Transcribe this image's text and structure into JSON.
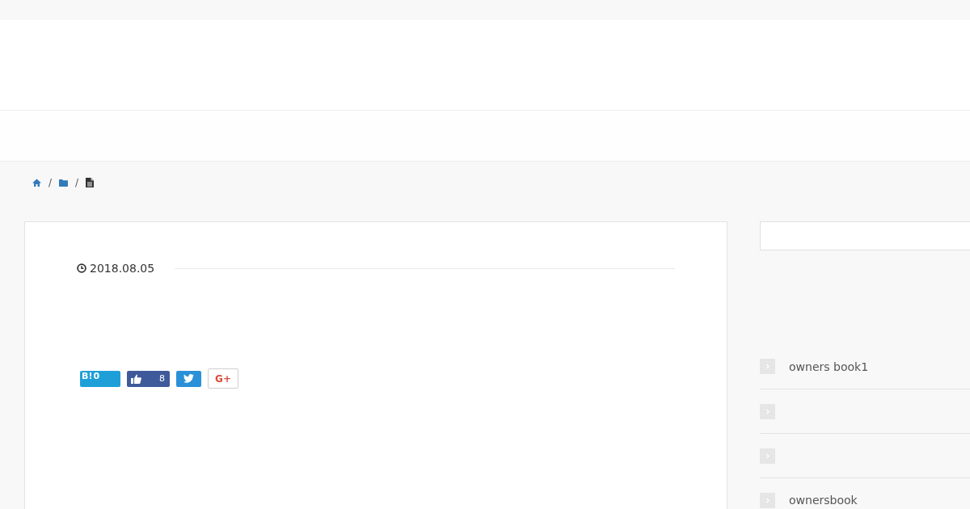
{
  "breadcrumb": [
    {
      "kind": "home"
    },
    {
      "kind": "separator",
      "text": "/"
    },
    {
      "kind": "folder"
    },
    {
      "kind": "separator",
      "text": "/"
    },
    {
      "kind": "page"
    }
  ],
  "post": {
    "date": "2018.08.05",
    "share_buttons": [
      {
        "kind": "bookmark",
        "label": "B!",
        "count": "0"
      },
      {
        "kind": "like",
        "count": "8"
      },
      {
        "kind": "tweet"
      },
      {
        "kind": "plus",
        "label": "G+"
      }
    ]
  },
  "sidebar": {
    "links": [
      {
        "kind": "text",
        "label": "owners book1"
      },
      {
        "kind": "blank"
      },
      {
        "kind": "blank"
      },
      {
        "kind": "text",
        "label": "ownersbook"
      }
    ]
  }
}
